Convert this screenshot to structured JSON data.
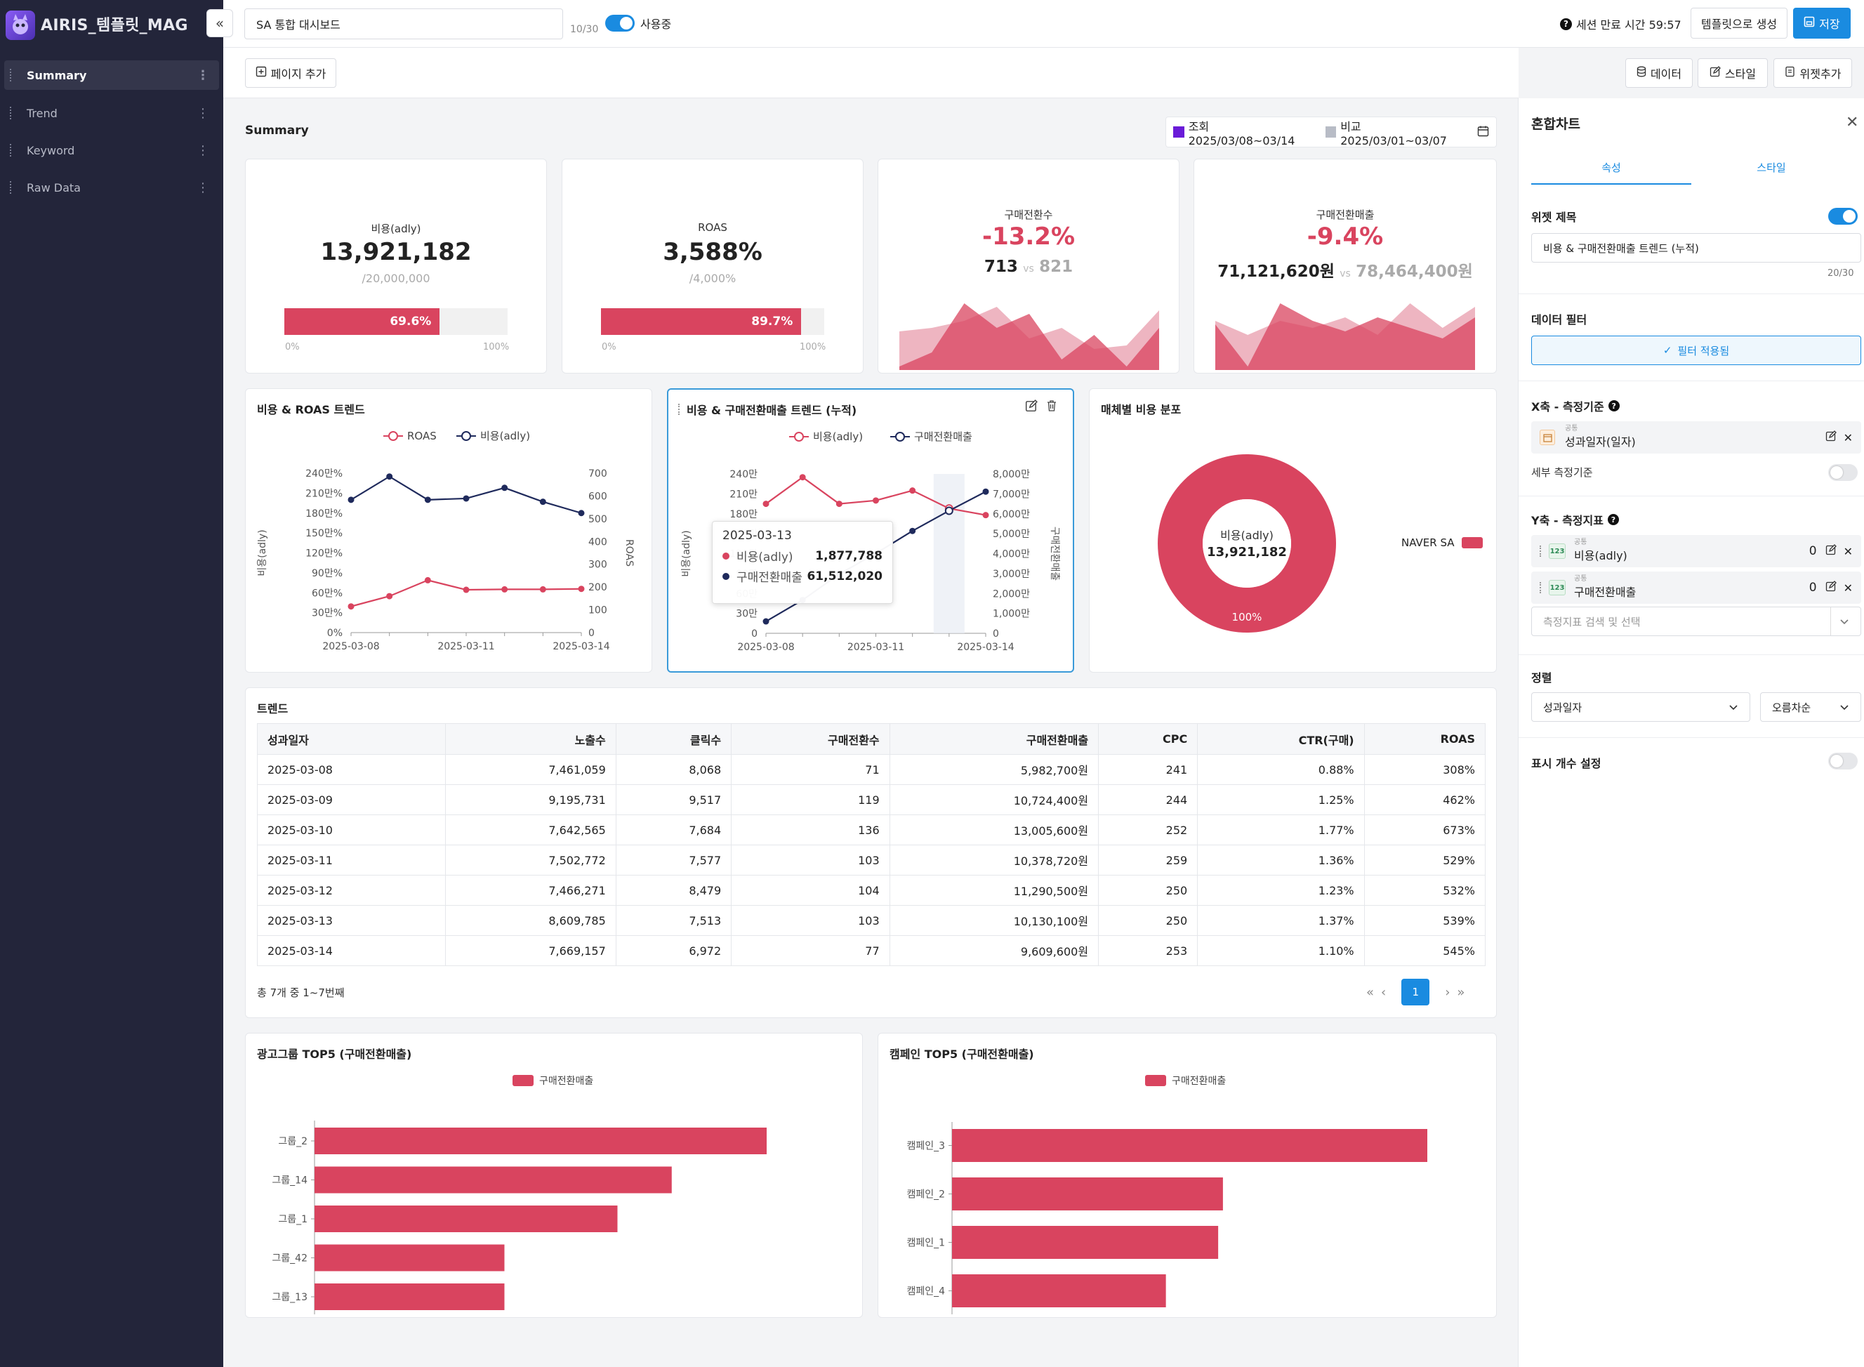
{
  "app": {
    "title": "AIRIS_템플릿_MAG"
  },
  "sidebar": {
    "items": [
      {
        "label": "Summary",
        "active": true
      },
      {
        "label": "Trend"
      },
      {
        "label": "Keyword"
      },
      {
        "label": "Raw Data"
      }
    ]
  },
  "topbar": {
    "dashboard_title": "SA 통합 대시보드",
    "title_counter": "10/30",
    "use_label": "사용중",
    "session_text": "세션 만료 시간 59:57",
    "template_button": "템플릿으로 생성",
    "save_button": "저장"
  },
  "toolbar": {
    "add_page": "페이지 추가",
    "data_button": "데이터",
    "style_button": "스타일",
    "widget_add_button": "위젯추가"
  },
  "summary": {
    "title": "Summary",
    "query_label": "조회 2025/03/08~03/14",
    "compare_label": "비교 2025/03/01~03/07",
    "query_color": "#6a1bd8",
    "compare_color": "#b8bcc6"
  },
  "kpis": [
    {
      "label": "비용(adly)",
      "value": "13,921,182",
      "target": "/20,000,000",
      "progress": 69.6,
      "progress_label": "69.6%",
      "scale_min": "0%",
      "scale_max": "100%"
    },
    {
      "label": "ROAS",
      "value": "3,588%",
      "target": "/4,000%",
      "progress": 89.7,
      "progress_label": "89.7%",
      "scale_min": "0%",
      "scale_max": "100%"
    },
    {
      "label": "구매전환수",
      "change": "-13.2%",
      "current": "713",
      "vs": "vs",
      "previous": "821",
      "spark_current": [
        0.05,
        0.25,
        0.95,
        0.6,
        0.8,
        0.15,
        0.5,
        0.05,
        0.6
      ],
      "spark_previous": [
        0.55,
        0.6,
        0.7,
        0.9,
        0.45,
        0.6,
        0.3,
        0.35,
        0.85
      ]
    },
    {
      "label": "구매전환매출",
      "change": "-9.4%",
      "current": "71,121,620원",
      "vs": "vs",
      "previous": "78,464,400원",
      "spark_current": [
        0.65,
        0.05,
        0.95,
        0.7,
        0.55,
        0.75,
        0.6,
        0.45,
        0.75
      ],
      "spark_previous": [
        0.7,
        0.5,
        0.7,
        0.6,
        0.75,
        0.5,
        0.95,
        0.6,
        0.9
      ]
    }
  ],
  "chart1": {
    "title": "비용 & ROAS 트렌드",
    "type": "line",
    "legend": [
      "ROAS",
      "비용(adly)"
    ],
    "x": [
      "2025-03-08",
      "2025-03-09",
      "2025-03-10",
      "2025-03-11",
      "2025-03-12",
      "2025-03-13",
      "2025-03-14"
    ],
    "x_ticks": [
      "2025-03-08",
      "2025-03-11",
      "2025-03-14"
    ],
    "left_ticks": [
      "0%",
      "30만%",
      "60만%",
      "90만%",
      "120만%",
      "150만%",
      "180만%",
      "210만%",
      "240만%"
    ],
    "right_ticks": [
      "0",
      "100",
      "200",
      "300",
      "400",
      "500",
      "600",
      "700"
    ],
    "ylabel_left": "비용(adly)",
    "ylabel_right": "ROAS",
    "roas": [
      115,
      160,
      230,
      188,
      190,
      190,
      192
    ],
    "cost": [
      200,
      235,
      200,
      202,
      218,
      197,
      180
    ]
  },
  "chart2": {
    "title": "비용 & 구매전환매출 트렌드 (누적)",
    "type": "line",
    "legend": [
      "비용(adly)",
      "구매전환매출"
    ],
    "x": [
      "2025-03-08",
      "2025-03-09",
      "2025-03-10",
      "2025-03-11",
      "2025-03-12",
      "2025-03-13",
      "2025-03-14"
    ],
    "x_ticks": [
      "2025-03-08",
      "2025-03-11",
      "2025-03-14"
    ],
    "left_ticks": [
      "0",
      "30만",
      "60만",
      "90만",
      "120만",
      "150만",
      "180만",
      "210만",
      "240만"
    ],
    "right_ticks": [
      "0",
      "1,000만",
      "2,000만",
      "3,000만",
      "4,000만",
      "5,000만",
      "6,000만",
      "7,000만",
      "8,000만"
    ],
    "ylabel_left": "비용(adly)",
    "ylabel_right": "구매전환매출",
    "cost": [
      195,
      235,
      195,
      200,
      215,
      188,
      178
    ],
    "revenue": [
      598,
      1670,
      2971,
      4009,
      5138,
      6151,
      7112
    ],
    "tooltip": {
      "date": "2025-03-13",
      "rows": [
        {
          "label": "비용(adly)",
          "value": "1,877,788"
        },
        {
          "label": "구매전환매출",
          "value": "61,512,020"
        }
      ]
    }
  },
  "donut": {
    "title": "매체별 비용 분포",
    "center_label": "비용(adly)",
    "center_value": "13,921,182",
    "percent_label": "100%",
    "legend": "NAVER SA",
    "color": "#d9445f",
    "chart_data": {
      "type": "pie",
      "categories": [
        "NAVER SA"
      ],
      "values": [
        100
      ]
    }
  },
  "trend_table": {
    "title": "트렌드",
    "columns": [
      "성과일자",
      "노출수",
      "클릭수",
      "구매전환수",
      "구매전환매출",
      "CPC",
      "CTR(구매)",
      "ROAS"
    ],
    "rows": [
      [
        "2025-03-08",
        "7,461,059",
        "8,068",
        "71",
        "5,982,700원",
        "241",
        "0.88%",
        "308%"
      ],
      [
        "2025-03-09",
        "9,195,731",
        "9,517",
        "119",
        "10,724,400원",
        "244",
        "1.25%",
        "462%"
      ],
      [
        "2025-03-10",
        "7,642,565",
        "7,684",
        "136",
        "13,005,600원",
        "252",
        "1.77%",
        "673%"
      ],
      [
        "2025-03-11",
        "7,502,772",
        "7,577",
        "103",
        "10,378,720원",
        "259",
        "1.36%",
        "529%"
      ],
      [
        "2025-03-12",
        "7,466,271",
        "8,479",
        "104",
        "11,290,500원",
        "250",
        "1.23%",
        "532%"
      ],
      [
        "2025-03-13",
        "8,609,785",
        "7,513",
        "103",
        "10,130,100원",
        "250",
        "1.37%",
        "539%"
      ],
      [
        "2025-03-14",
        "7,669,157",
        "6,972",
        "77",
        "9,609,600원",
        "253",
        "1.10%",
        "545%"
      ]
    ],
    "footer": "총 7개 중 1~7번째",
    "page": "1"
  },
  "bar1": {
    "title": "광고그룹 TOP5 (구매전환매출)",
    "legend": "구매전환매출",
    "chart_data": {
      "type": "bar",
      "categories": [
        "그룹_2",
        "그룹_14",
        "그룹_1",
        "그룹_42",
        "그룹_13"
      ],
      "values": [
        100,
        79,
        67,
        42,
        42
      ]
    }
  },
  "bar2": {
    "title": "캠페인 TOP5 (구매전환매출)",
    "legend": "구매전환매출",
    "chart_data": {
      "type": "bar",
      "categories": [
        "캠페인_3",
        "캠페인_2",
        "캠페인_1",
        "캠페인_4"
      ],
      "values": [
        100,
        57,
        56,
        45
      ]
    }
  },
  "rpanel": {
    "title": "혼합차트",
    "tab_props": "속성",
    "tab_style": "스타일",
    "widget_title_label": "위젯 제목",
    "widget_title_value": "비용 & 구매전환매출 트렌드 (누적)",
    "widget_title_counter": "20/30",
    "data_filter_label": "데이터 필터",
    "filter_button": "필터 적용됨",
    "x_axis_label": "X축 - 측정기준",
    "x_axis_tag": "공통",
    "x_axis_value": "성과일자(일자)",
    "sub_dimension_label": "세부 측정기준",
    "y_axis_label": "Y축 - 측정지표",
    "y_metrics": [
      {
        "tag": "공통",
        "name": "비용(adly)",
        "count": "0"
      },
      {
        "tag": "공통",
        "name": "구매전환매출",
        "count": "0"
      }
    ],
    "metric_search_placeholder": "측정지표 검색 및 선택",
    "sort_label": "정렬",
    "sort_field": "성과일자",
    "sort_order": "오름차순",
    "display_count_label": "표시 개수 설정"
  }
}
